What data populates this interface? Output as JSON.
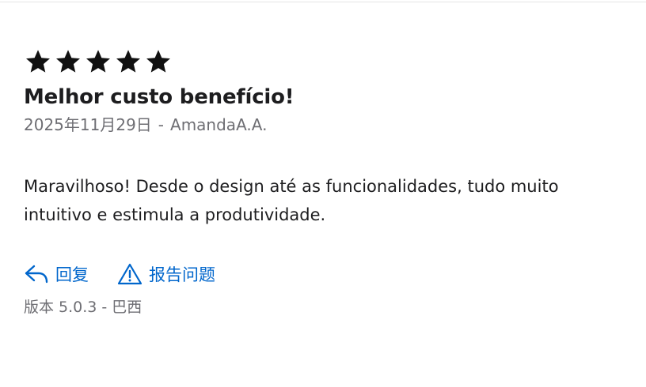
{
  "review": {
    "rating": 5,
    "max_rating": 5,
    "title": "Melhor custo benefício!",
    "date": "2025年11月29日",
    "separator": "-",
    "author": "AmandaA.A.",
    "body": "Maravilhoso! Desde o design até as funcionalidades, tudo muito intuitivo e estimula a produtividade."
  },
  "actions": {
    "reply_label": "回复",
    "report_label": "报告问题"
  },
  "version": {
    "label": "版本 5.0.3",
    "separator": "-",
    "country": "巴西"
  },
  "colors": {
    "link": "#0066cc",
    "secondary_text": "#6e6e73",
    "star": "#1d1d1f"
  }
}
